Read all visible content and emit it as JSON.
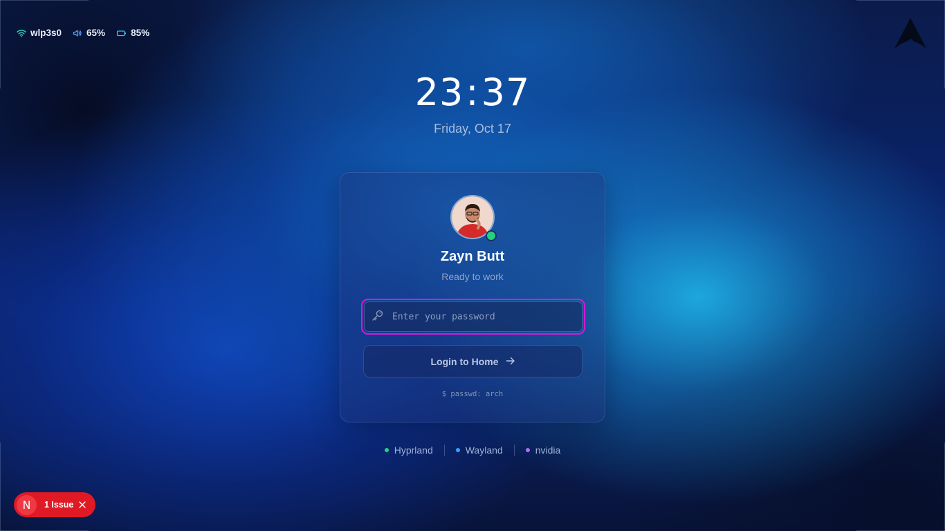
{
  "status_bar": {
    "network": "wlp3s0",
    "volume": "65%",
    "battery": "85%"
  },
  "clock": {
    "hours": "23",
    "separator": ":",
    "minutes": "37",
    "date": "Friday, Oct 17"
  },
  "login_card": {
    "user_name": "Zayn Butt",
    "user_status": "Ready to work",
    "password_placeholder": "Enter your password",
    "login_button_label": "Login to Home",
    "hint": "$ passwd: arch"
  },
  "sessions": [
    {
      "label": "Hyprland",
      "color": "#1fd67f"
    },
    {
      "label": "Wayland",
      "color": "#3aa0ff"
    },
    {
      "label": "nvidia",
      "color": "#b06cff"
    }
  ],
  "issue_badge": {
    "icon_letter": "N",
    "label": "1 Issue"
  },
  "icons": {
    "wifi": "wifi-icon",
    "volume": "volume-icon",
    "battery": "battery-icon",
    "logo": "arch-logo",
    "key": "key-icon",
    "arrow": "arrow-right-icon",
    "close": "close-icon"
  },
  "colors": {
    "accent_wifi": "#2fd3b0",
    "accent_volume": "#5aa7ff",
    "accent_battery": "#2fc7e8",
    "focus_ring": "#d21ad8",
    "online": "#22d27a",
    "issue": "#e01a24"
  }
}
